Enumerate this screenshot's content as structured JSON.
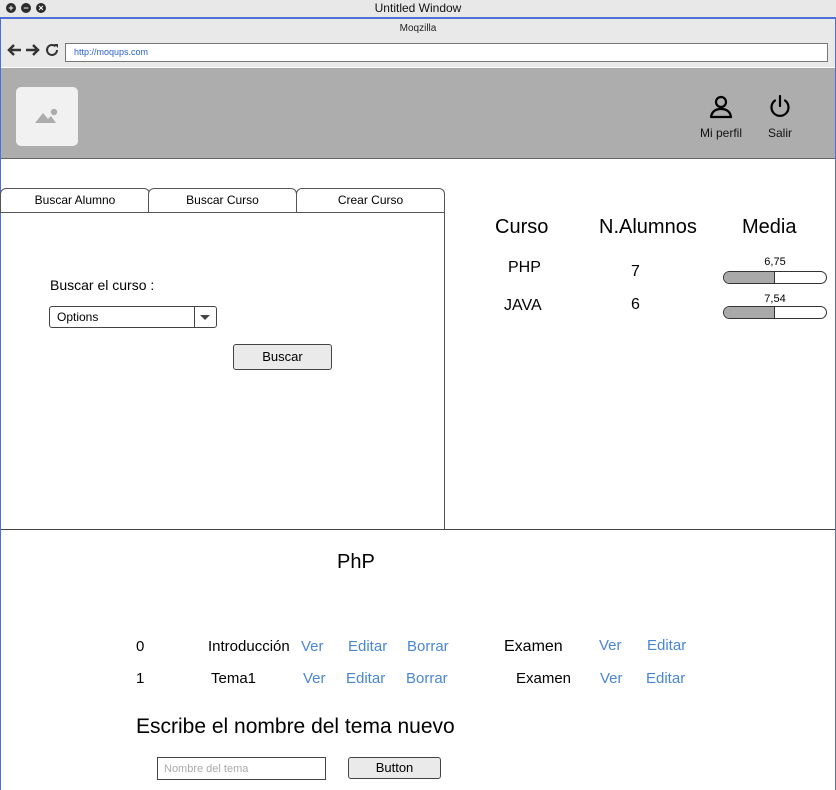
{
  "window": {
    "title": "Untitled Window"
  },
  "browser": {
    "name": "Moqzilla",
    "url": "http://moqups.com"
  },
  "header": {
    "profile_label": "Mi perfil",
    "logout_label": "Salir"
  },
  "tabs": [
    {
      "label": "Buscar Alumno"
    },
    {
      "label": "Buscar Curso"
    },
    {
      "label": "Crear Curso"
    }
  ],
  "search_panel": {
    "label": "Buscar el curso :",
    "select_value": "Options",
    "button_label": "Buscar"
  },
  "stats": {
    "headers": [
      "Curso",
      "N.Alumnos",
      "Media"
    ],
    "rows": [
      {
        "course": "PHP",
        "students": "7",
        "average": "6,75",
        "average_fill": 0.5
      },
      {
        "course": "JAVA",
        "students": "6",
        "average": "7,54",
        "average_fill": 0.5
      }
    ]
  },
  "course_detail": {
    "title": "PhP",
    "topics": [
      {
        "index": "0",
        "name": "Introducción",
        "view": "Ver",
        "edit": "Editar",
        "delete": "Borrar",
        "exam": "Examen",
        "exam_view": "Ver",
        "exam_edit": "Editar"
      },
      {
        "index": "1",
        "name": "Tema1",
        "view": "Ver",
        "edit": "Editar",
        "delete": "Borrar",
        "exam": "Examen",
        "exam_view": "Ver",
        "exam_edit": "Editar"
      }
    ],
    "new_topic_heading": "Escribe el nombre del tema nuevo",
    "new_topic_placeholder": "Nombre del tema",
    "new_topic_button": "Button"
  }
}
